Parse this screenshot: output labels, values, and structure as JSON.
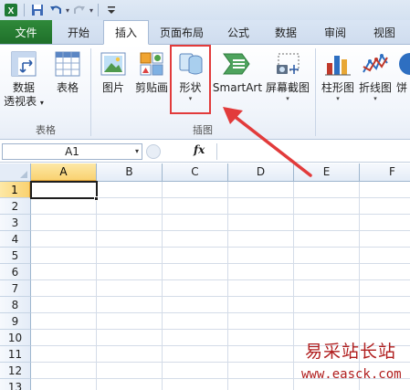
{
  "quick_access": {
    "save_icon": "save-icon",
    "undo_icon": "undo-icon",
    "redo_icon": "redo-icon"
  },
  "tabs": [
    {
      "label": "文件"
    },
    {
      "label": "开始"
    },
    {
      "label": "插入"
    },
    {
      "label": "页面布局"
    },
    {
      "label": "公式"
    },
    {
      "label": "数据"
    },
    {
      "label": "审阅"
    },
    {
      "label": "视图"
    }
  ],
  "ribbon": {
    "pivot_table": {
      "label1": "数据",
      "label2": "透视表",
      "caret": "▾"
    },
    "table": {
      "label": "表格"
    },
    "tables_group": "表格",
    "picture": {
      "label": "图片"
    },
    "clip_art": {
      "label": "剪贴画"
    },
    "shapes": {
      "label": "形状",
      "caret": "▾"
    },
    "smartart": {
      "label": "SmartArt"
    },
    "screenshot": {
      "label": "屏幕截图",
      "caret": "▾"
    },
    "illustrations_group": "插图",
    "column_chart": {
      "label": "柱形图",
      "caret": "▾"
    },
    "line_chart": {
      "label": "折线图",
      "caret": "▾"
    },
    "pie_chart": {
      "label": "饼"
    }
  },
  "formula_bar": {
    "name_box": "A1",
    "fx": "fx",
    "value": ""
  },
  "grid": {
    "columns": [
      "A",
      "B",
      "C",
      "D",
      "E",
      "F"
    ],
    "rows": [
      "1",
      "2",
      "3",
      "4",
      "5",
      "6",
      "7",
      "8",
      "9",
      "10",
      "11",
      "12",
      "13"
    ],
    "selected_cell": "A1"
  },
  "watermark": {
    "chinese": "易采站长站",
    "url": "www.easck.com"
  },
  "colors": {
    "file_tab": "#1f6f2a",
    "highlight_box": "#e23b3b",
    "selection_header": "#f9d271"
  }
}
